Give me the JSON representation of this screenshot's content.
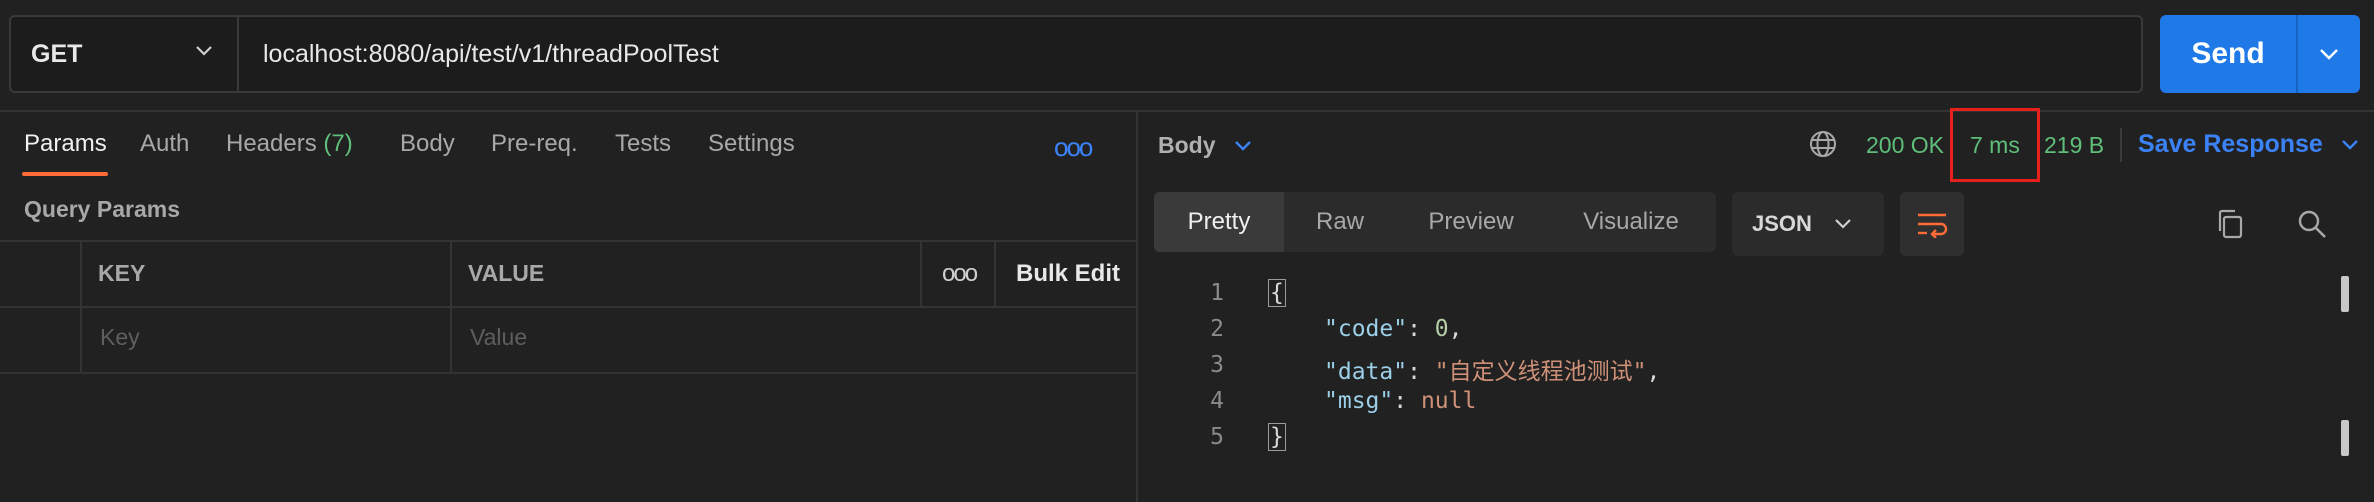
{
  "request": {
    "method": "GET",
    "url": "localhost:8080/api/test/v1/threadPoolTest",
    "send_label": "Send"
  },
  "request_tabs": [
    {
      "label": "Params",
      "active": true
    },
    {
      "label": "Auth"
    },
    {
      "label": "Headers",
      "count": "(7)"
    },
    {
      "label": "Body"
    },
    {
      "label": "Pre-req."
    },
    {
      "label": "Tests"
    },
    {
      "label": "Settings"
    }
  ],
  "more_icon": "ooo",
  "query_params": {
    "title": "Query Params",
    "columns": {
      "key": "KEY",
      "value": "VALUE",
      "more": "ooo",
      "bulk_edit": "Bulk Edit"
    },
    "placeholder": {
      "key": "Key",
      "value": "Value"
    }
  },
  "response": {
    "body_selector": "Body",
    "status": "200 OK",
    "time": "7 ms",
    "size": "219 B",
    "save_label": "Save Response",
    "view_tabs": [
      "Pretty",
      "Raw",
      "Preview",
      "Visualize"
    ],
    "format": "JSON",
    "line_numbers": [
      "1",
      "2",
      "3",
      "4",
      "5"
    ],
    "json": {
      "open": "{",
      "close": "}",
      "code_key": "\"code\"",
      "code_val": "0",
      "data_key": "\"data\"",
      "data_val": "\"自定义线程池测试\"",
      "msg_key": "\"msg\"",
      "msg_val": "null",
      "colon": ": ",
      "comma": ","
    }
  },
  "colors": {
    "accent": "#1f7ae8",
    "status_green": "#5fbf7a",
    "tab_underline": "#ff6c37",
    "highlight_box": "#e8201d"
  }
}
